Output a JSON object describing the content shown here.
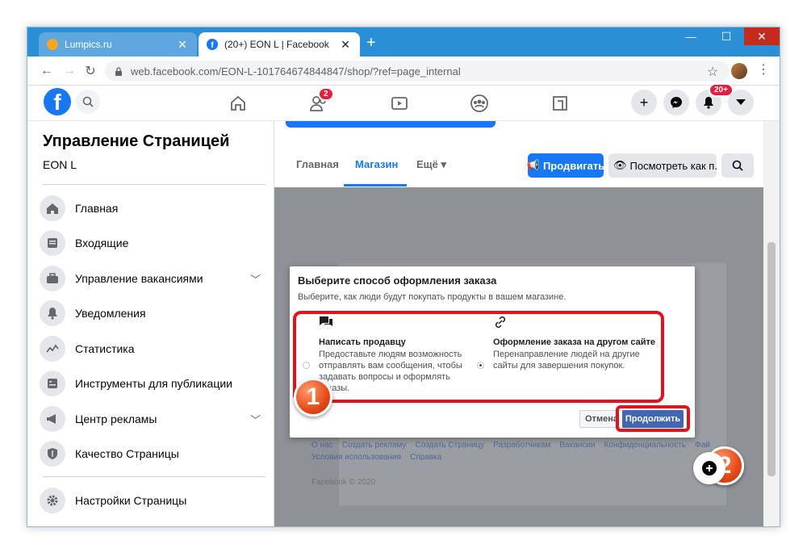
{
  "browser": {
    "tabs": [
      {
        "title": "Lumpics.ru",
        "active": false,
        "favicon_color": "#f5a623"
      },
      {
        "title": "(20+) EON L | Facebook",
        "active": true,
        "favicon_color": "#1877f2"
      }
    ],
    "url": "web.facebook.com/EON-L-101764674844847/shop/?ref=page_internal"
  },
  "fb_nav": {
    "friends_badge": "2",
    "notifications_badge": "20+"
  },
  "sidebar": {
    "title": "Управление Страницей",
    "page_name": "EON L",
    "items": [
      {
        "label": "Главная",
        "icon": "home-icon",
        "expandable": false
      },
      {
        "label": "Входящие",
        "icon": "inbox-icon",
        "expandable": false
      },
      {
        "label": "Управление вакансиями",
        "icon": "briefcase-icon",
        "expandable": true
      },
      {
        "label": "Уведомления",
        "icon": "bell-icon",
        "expandable": false
      },
      {
        "label": "Статистика",
        "icon": "chart-icon",
        "expandable": false
      },
      {
        "label": "Инструменты для публикации",
        "icon": "tools-icon",
        "expandable": false
      },
      {
        "label": "Центр рекламы",
        "icon": "megaphone-icon",
        "expandable": true
      },
      {
        "label": "Качество Страницы",
        "icon": "shield-icon",
        "expandable": false
      }
    ],
    "settings_label": "Настройки Страницы"
  },
  "page_tabs": {
    "home": "Главная",
    "shop": "Магазин",
    "more": "Ещё",
    "promote": "Продвигать",
    "view_as": "Посмотреть как п..."
  },
  "dialog": {
    "title": "Выберите способ оформления заказа",
    "subtitle": "Выберите, как люди будут покупать продукты в вашем магазине.",
    "option_message": {
      "title": "Написать продавцу",
      "description": "Предоставьте людям возможность отправлять вам сообщения, чтобы задавать вопросы и оформлять заказы.",
      "selected": false
    },
    "option_website": {
      "title": "Оформление заказа на другом сайте",
      "description": "Перенаправление людей на другие сайты для завершения покупок.",
      "selected": true
    },
    "cancel_label": "Отмена",
    "continue_label": "Продолжить"
  },
  "footer": {
    "links_row1": "О нас    Создать рекламу    Создать Страницу    Разработчикам    Вакансии    Конфиденциальность    Фай",
    "links_row2": "Условия использования    Справка",
    "copyright": "Facebook © 2020"
  },
  "annotations": {
    "marker1": "1",
    "marker2": "2",
    "highlight_color": "#e3121c"
  }
}
